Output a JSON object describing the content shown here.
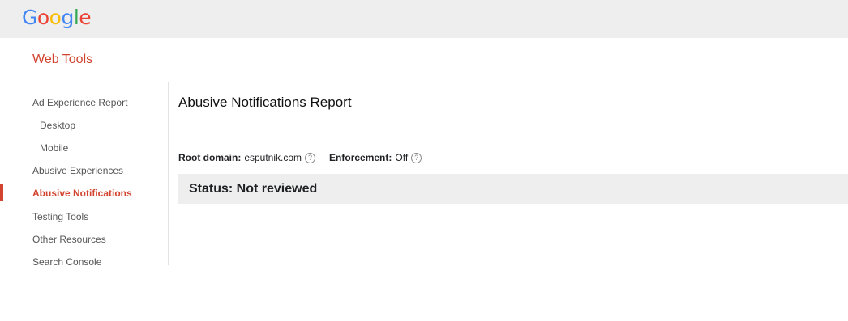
{
  "logo": {
    "letters": [
      "G",
      "o",
      "o",
      "g",
      "l",
      "e"
    ],
    "colors": [
      "#4285F4",
      "#EA4335",
      "#FBBC05",
      "#4285F4",
      "#34A853",
      "#EA4335"
    ]
  },
  "header": {
    "product_title": "Web Tools"
  },
  "sidebar": {
    "items": [
      {
        "label": "Ad Experience Report"
      },
      {
        "label": "Desktop"
      },
      {
        "label": "Mobile"
      },
      {
        "label": "Abusive Experiences"
      },
      {
        "label": "Abusive Notifications"
      },
      {
        "label": "Testing Tools"
      },
      {
        "label": "Other Resources"
      },
      {
        "label": "Search Console"
      }
    ],
    "active_color": "#d2442f"
  },
  "main": {
    "title": "Abusive Notifications Report",
    "root_domain_label": "Root domain:",
    "root_domain_value": "esputnik.com",
    "enforcement_label": "Enforcement:",
    "enforcement_value": "Off",
    "help_glyph": "?",
    "status": "Status: Not reviewed"
  }
}
